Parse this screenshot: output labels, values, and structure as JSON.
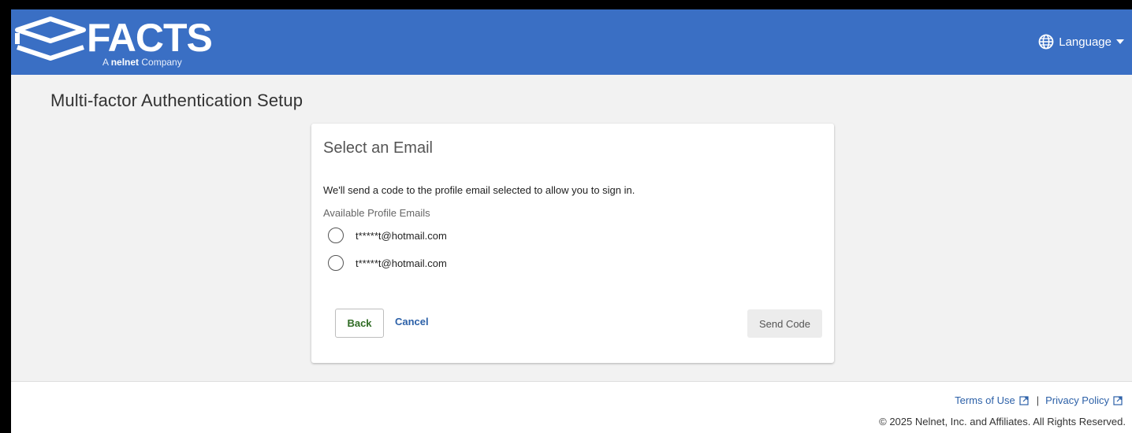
{
  "header": {
    "brand": "FACTS",
    "tagline_prefix": "A",
    "tagline_brand": "nelnet",
    "tagline_suffix": "Company",
    "language_label": "Language",
    "color": "#3a6fc4"
  },
  "page": {
    "title": "Multi-factor Authentication Setup"
  },
  "card": {
    "title": "Select an Email",
    "description": "We'll send a code to the profile email selected to allow you to sign in.",
    "list_label": "Available Profile Emails",
    "emails": [
      "t*****t@hotmail.com",
      "t*****t@hotmail.com"
    ],
    "back_label": "Back",
    "cancel_label": "Cancel",
    "send_label": "Send Code"
  },
  "footer": {
    "terms_label": "Terms of Use",
    "separator": "|",
    "privacy_label": "Privacy Policy",
    "copyright": "© 2025 Nelnet, Inc. and Affiliates. All Rights Reserved."
  },
  "icons": {
    "logo": "facts-logo-icon",
    "globe": "globe-icon",
    "caret": "caret-down-icon",
    "external_link": "external-link-icon"
  }
}
